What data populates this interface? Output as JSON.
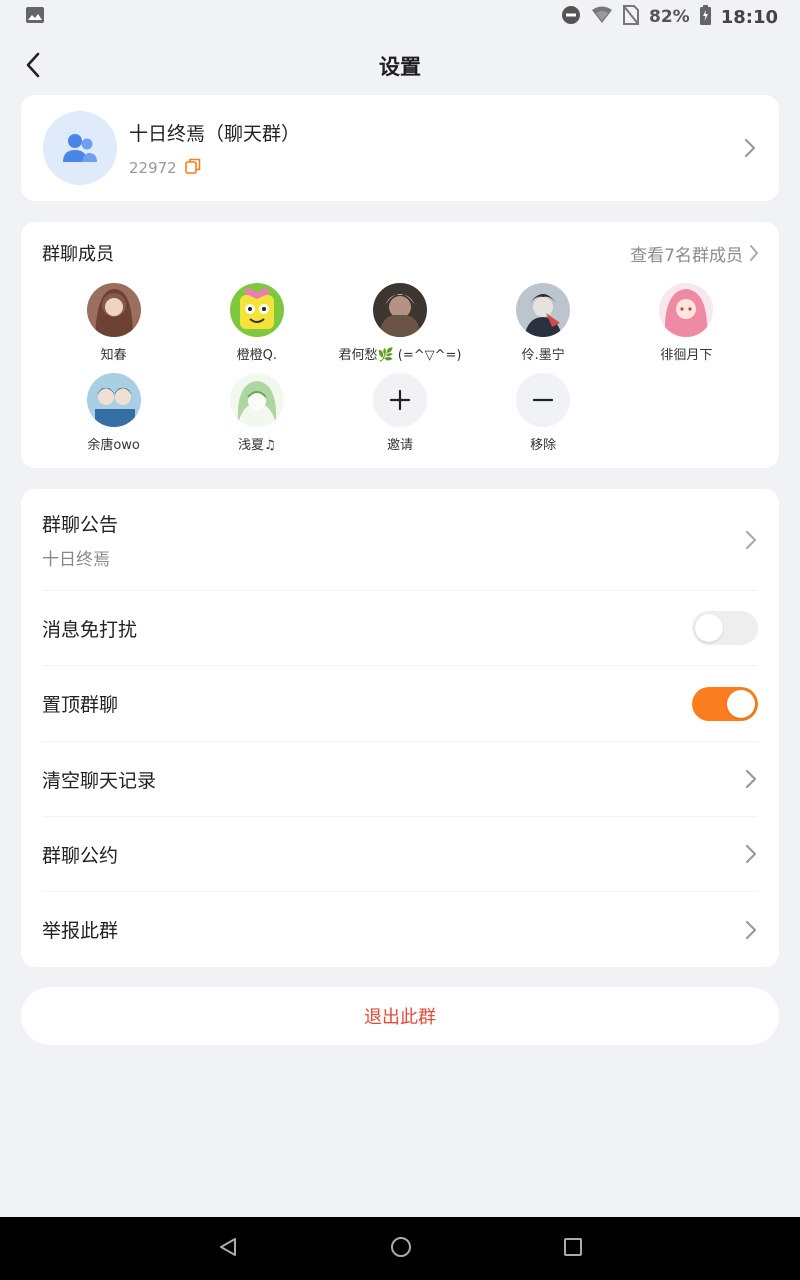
{
  "status_bar": {
    "battery": "82%",
    "time": "18:10"
  },
  "header": {
    "title": "设置"
  },
  "group": {
    "name": "十日终焉（聊天群）",
    "id": "22972"
  },
  "members_section": {
    "title": "群聊成员",
    "view_all": "查看7名群成员",
    "members": [
      {
        "name": "知春"
      },
      {
        "name": "橙橙Q."
      },
      {
        "name": "君何愁🌿 (=^▽^=)"
      },
      {
        "name": "伶.墨宁"
      },
      {
        "name": "徘徊月下"
      },
      {
        "name": "余唐owo"
      },
      {
        "name": "浅夏♫"
      }
    ],
    "invite_label": "邀请",
    "remove_label": "移除"
  },
  "settings": {
    "announcement_label": "群聊公告",
    "announcement_text": "十日终焉",
    "mute_label": "消息免打扰",
    "mute_on": false,
    "pin_label": "置顶群聊",
    "pin_on": true,
    "clear_history_label": "清空聊天记录",
    "rules_label": "群聊公约",
    "report_label": "举报此群"
  },
  "exit_label": "退出此群",
  "colors": {
    "accent": "#fb7d1f",
    "danger": "#e44a3c",
    "background": "#f1f2f6"
  }
}
